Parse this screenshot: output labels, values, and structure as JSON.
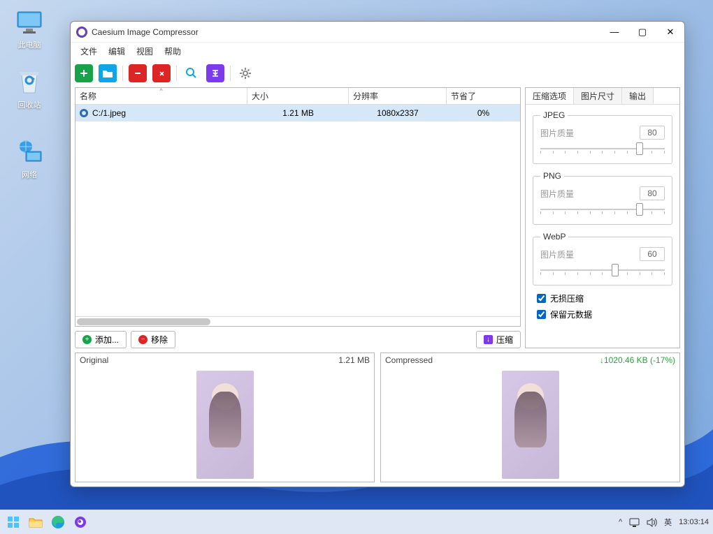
{
  "desktop": {
    "this_pc": "此电脑",
    "recycle": "回收站",
    "network": "网络"
  },
  "taskbar": {
    "ime": "英",
    "time": "13:03:14"
  },
  "window": {
    "title": "Caesium Image Compressor"
  },
  "menu": {
    "file": "文件",
    "edit": "编辑",
    "view": "视图",
    "help": "帮助"
  },
  "table": {
    "headers": {
      "name": "名称",
      "size": "大小",
      "resolution": "分辨率",
      "saved": "节省了"
    },
    "rows": [
      {
        "name": "C:/1.jpeg",
        "size": "1.21 MB",
        "resolution": "1080x2337",
        "saved": "0%"
      }
    ]
  },
  "actions": {
    "add": "添加...",
    "remove": "移除",
    "compress": "压缩"
  },
  "sidebar": {
    "tabs": {
      "options": "压缩选项",
      "dims": "图片尺寸",
      "output": "输出"
    },
    "jpeg": {
      "legend": "JPEG",
      "qlabel": "图片质量",
      "qval": "80",
      "knob": 80
    },
    "png": {
      "legend": "PNG",
      "qlabel": "图片质量",
      "qval": "80",
      "knob": 80
    },
    "webp": {
      "legend": "WebP",
      "qlabel": "图片质量",
      "qval": "60",
      "knob": 60
    },
    "lossless": "无损压缩",
    "metadata": "保留元数据"
  },
  "preview": {
    "orig_label": "Original",
    "orig_size": "1.21 MB",
    "comp_label": "Compressed",
    "comp_size": "1020.46 KB (-17%)"
  }
}
